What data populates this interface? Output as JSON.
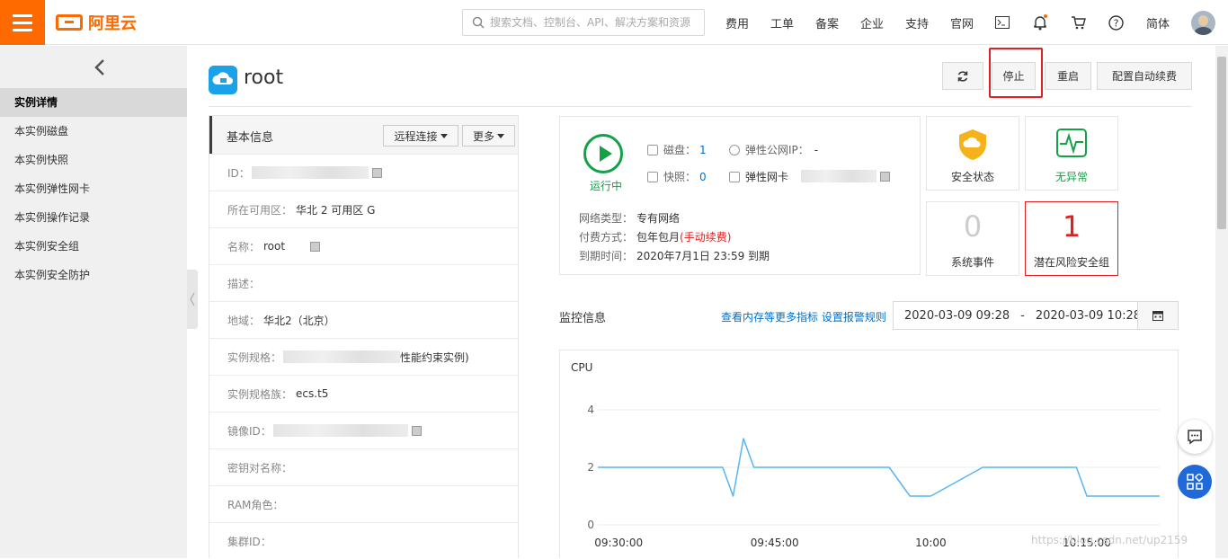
{
  "header": {
    "logo_text": "阿里云",
    "search_placeholder": "搜索文档、控制台、API、解决方案和资源",
    "nav": [
      "费用",
      "工单",
      "备案",
      "企业",
      "支持",
      "官网"
    ],
    "lang": "简体",
    "icons": [
      "terminal-icon",
      "bell-icon",
      "cart-icon",
      "help-icon"
    ]
  },
  "sidebar": {
    "items": [
      "实例详情",
      "本实例磁盘",
      "本实例快照",
      "本实例弹性网卡",
      "本实例操作记录",
      "本实例安全组",
      "本实例安全防护"
    ],
    "active_index": 0
  },
  "page": {
    "title": "root",
    "toolbar": {
      "stop": "停止",
      "restart": "重启",
      "auto_renew": "配置自动续费"
    }
  },
  "basic_info": {
    "title": "基本信息",
    "remote_btn": "远程连接",
    "more_btn": "更多",
    "rows": [
      {
        "label": "ID：",
        "value": ""
      },
      {
        "label": "所在可用区：",
        "value": "华北 2 可用区 G"
      },
      {
        "label": "名称：",
        "value": "root"
      },
      {
        "label": "描述：",
        "value": ""
      },
      {
        "label": "地域：",
        "value": "华北2（北京）"
      },
      {
        "label": "实例规格：",
        "value": "性能约束实例)"
      },
      {
        "label": "实例规格族：",
        "value": "ecs.t5"
      },
      {
        "label": "镜像ID：",
        "value": ""
      },
      {
        "label": "密钥对名称：",
        "value": ""
      },
      {
        "label": "RAM角色：",
        "value": ""
      },
      {
        "label": "集群ID：",
        "value": ""
      }
    ]
  },
  "status": {
    "state": "运行中",
    "disk_label": "磁盘：",
    "disk_count": "1",
    "snapshot_label": "快照：",
    "snapshot_count": "0",
    "public_ip_label": "弹性公网IP：",
    "public_ip_value": "-",
    "eni_label": "弹性网卡",
    "network_type_label": "网络类型：",
    "network_type_value": "专有网络",
    "billing_label": "付费方式：",
    "billing_value": "包年包月",
    "billing_note": "(手动续费)",
    "expire_label": "到期时间：",
    "expire_value": "2020年7月1日 23:59 到期"
  },
  "cards": {
    "security_state": "安全状态",
    "no_anomaly": "无异常",
    "system_events_count": "0",
    "system_events": "系统事件",
    "risk_group_count": "1",
    "risk_group": "潜在风险安全组"
  },
  "monitor": {
    "title": "监控信息",
    "links": "查看内存等更多指标 设置报警规则",
    "start": "2020-03-09 09:28",
    "sep": "-",
    "end": "2020-03-09 10:28"
  },
  "chart_data": {
    "type": "line",
    "title": "CPU",
    "x_ticks": [
      "09:30:00",
      "09:45:00",
      "10:00",
      "10:15:00"
    ],
    "y_ticks": [
      "4",
      "2",
      "0"
    ],
    "ylim": [
      0,
      4
    ],
    "series": [
      {
        "x": [
          "09:28",
          "09:40",
          "09:41",
          "09:42",
          "09:43",
          "09:44",
          "09:54",
          "09:56",
          "09:58",
          "10:00",
          "10:05",
          "10:10",
          "10:14",
          "10:15",
          "10:22"
        ],
        "values": [
          2,
          2,
          1,
          3,
          2,
          2,
          2,
          2,
          1,
          1,
          2,
          2,
          2,
          1,
          1
        ]
      }
    ],
    "grid": true,
    "color": "#57b6f0"
  },
  "watermark": "https://blog.csdn.net/up2159"
}
